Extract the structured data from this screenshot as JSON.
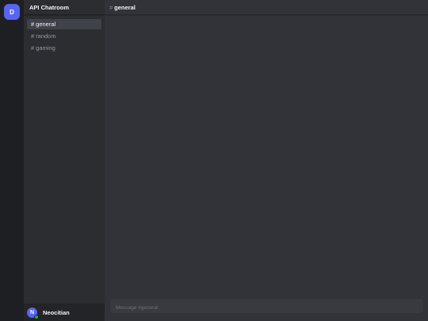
{
  "server": {
    "icon_letter": "D",
    "name": "API Chatroom"
  },
  "sidebar": {
    "channels": [
      {
        "hash": "#",
        "name": "general",
        "active": true
      },
      {
        "hash": "#",
        "name": "random",
        "active": false
      },
      {
        "hash": "#",
        "name": "gaming",
        "active": false
      }
    ]
  },
  "user": {
    "avatar_letter": "N",
    "name": "Neocitian",
    "status_color": "#23a55a"
  },
  "main": {
    "header": {
      "hash": "#",
      "channel_name": "general"
    },
    "composer": {
      "placeholder": "Message #general",
      "value": ""
    }
  },
  "colors": {
    "accent": "#5865f2",
    "rail": "#1e1f22",
    "sidebar": "#2b2d31",
    "chat": "#313338"
  }
}
